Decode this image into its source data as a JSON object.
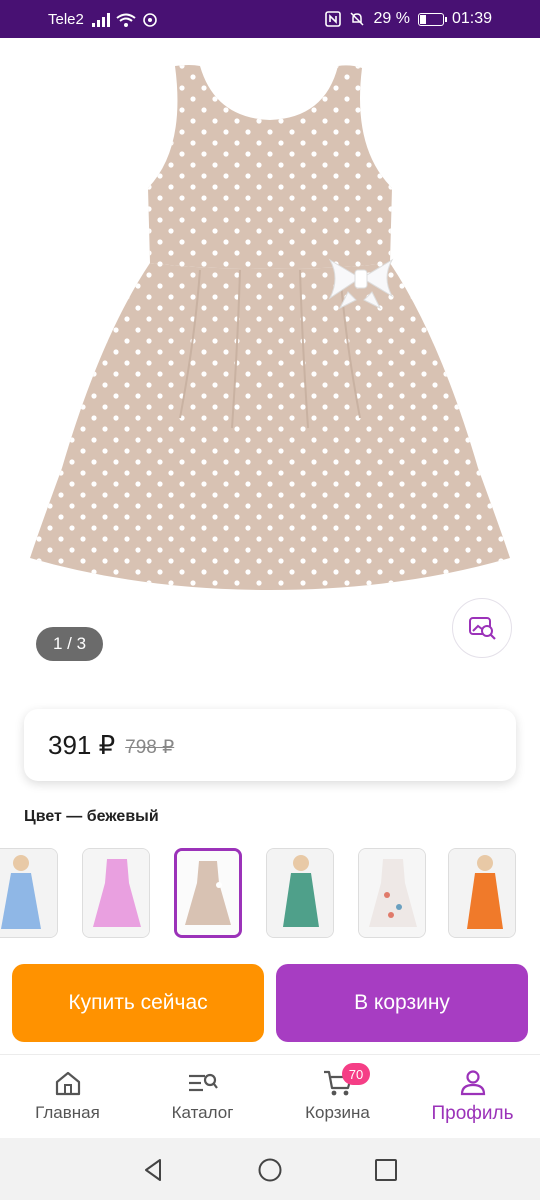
{
  "status_bar": {
    "carrier": "Tele2",
    "battery": "29 %",
    "time": "01:39",
    "battery_level": 0.29
  },
  "gallery": {
    "counter": "1 / 3",
    "search_similar_icon": "image-search-icon"
  },
  "price": {
    "current": "391 ₽",
    "old": "798 ₽"
  },
  "color": {
    "label": "Цвет — бежевый"
  },
  "thumbnails": [
    {
      "color": "blue",
      "selected": false
    },
    {
      "color": "pink",
      "selected": false
    },
    {
      "color": "beige",
      "selected": true
    },
    {
      "color": "green-print",
      "selected": false
    },
    {
      "color": "floral",
      "selected": false
    },
    {
      "color": "orange",
      "selected": false
    }
  ],
  "actions": {
    "buy_now": "Купить сейчас",
    "add_to_cart": "В корзину"
  },
  "bottom_nav": {
    "items": [
      {
        "label": "Главная",
        "icon": "home-icon"
      },
      {
        "label": "Каталог",
        "icon": "catalog-icon"
      },
      {
        "label": "Корзина",
        "icon": "cart-icon",
        "badge": "70"
      },
      {
        "label": "Профиль",
        "icon": "profile-icon",
        "active": true
      }
    ]
  },
  "colors": {
    "status_bar": "#481173",
    "accent": "#a73dc2",
    "buy_now": "#ff9200",
    "badge": "#f53e86",
    "dress": "#d8c2b3"
  }
}
